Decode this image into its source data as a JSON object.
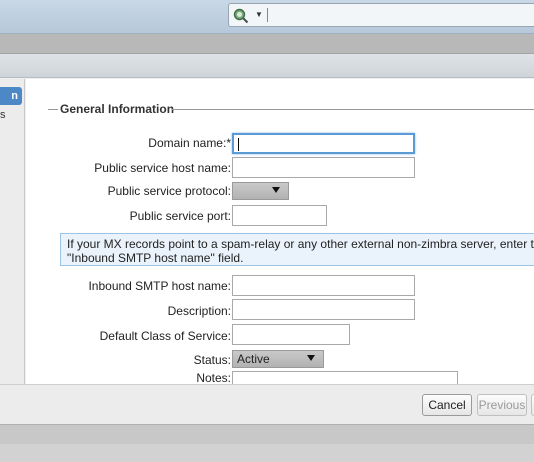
{
  "toolbar": {
    "search_icon": "search-icon",
    "dropdown_caret": "▼"
  },
  "nav": {
    "selected_item": "n",
    "item2": "s"
  },
  "form": {
    "legend": "General Information",
    "domain_name_label": "Domain name:*",
    "domain_name_value": "",
    "public_host_label": "Public service host name:",
    "public_host_value": "",
    "public_protocol_label": "Public service protocol:",
    "public_protocol_value": "",
    "public_port_label": "Public service port:",
    "public_port_value": "",
    "info_line1": "If your MX records point to a spam-relay or any other external non-zimbra server, enter the name of",
    "info_line2": "\"Inbound SMTP host name\" field.",
    "inbound_smtp_label": "Inbound SMTP host name:",
    "inbound_smtp_value": "",
    "description_label": "Description:",
    "description_value": "",
    "default_cos_label": "Default Class of Service:",
    "default_cos_value": "",
    "status_label": "Status:",
    "status_value": "Active",
    "notes_label": "Notes:",
    "notes_value": ""
  },
  "footer": {
    "cancel_label": "Cancel",
    "previous_label": "Previous"
  },
  "colors": {
    "accent": "#4d88c6",
    "focus": "#5b9bd5",
    "info_bg": "#eaf3fb"
  }
}
